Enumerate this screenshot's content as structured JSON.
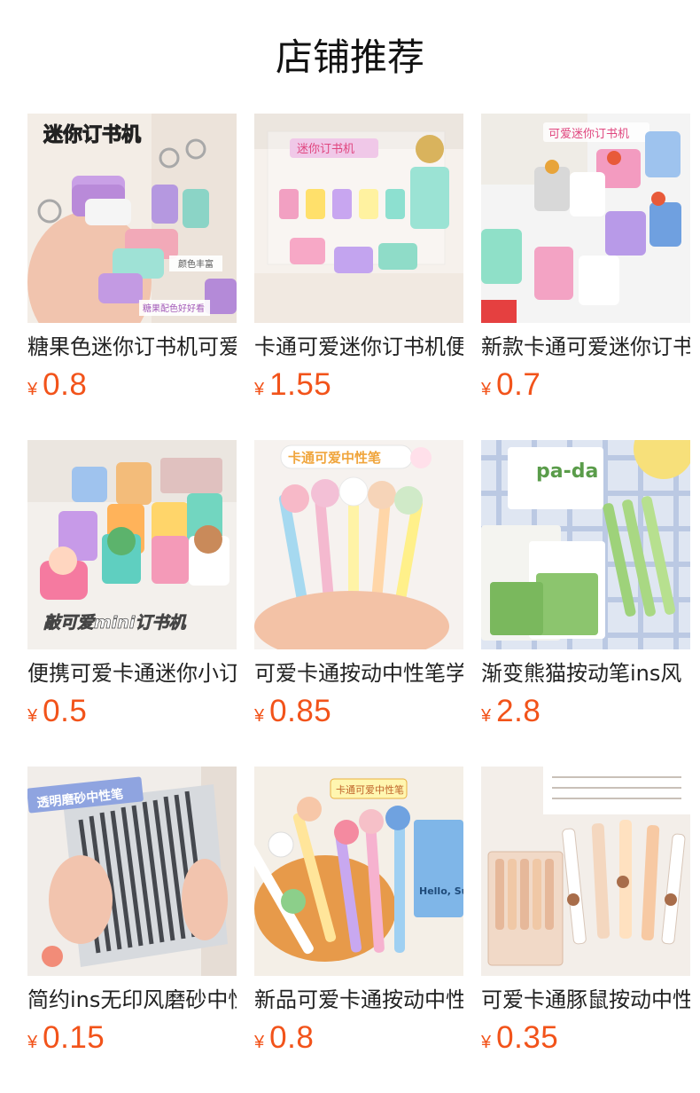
{
  "header": {
    "title": "店铺推荐"
  },
  "currency_symbol": "¥",
  "products": [
    {
      "name": "糖果色迷你订书机可爱",
      "price": "0.8",
      "image": {
        "badge": "迷你订书机",
        "tag1": "颜色丰富",
        "tag2": "糖果配色好好看"
      }
    },
    {
      "name": "卡通可爱迷你订书机便携",
      "price": "1.55",
      "image": {
        "badge": "迷你订书机"
      }
    },
    {
      "name": "新款卡通可爱迷你订书机",
      "price": "0.7",
      "image": {
        "badge": "可爱迷你订书机"
      }
    },
    {
      "name": "便携可爱卡通迷你小订书机",
      "price": "0.5",
      "image": {
        "badge": "敲可爱mini订书机"
      }
    },
    {
      "name": "可爱卡通按动中性笔学生",
      "price": "0.85",
      "image": {
        "badge": "卡通可爱中性笔"
      }
    },
    {
      "name": "渐变熊猫按动笔ins风",
      "price": "2.8",
      "image": {
        "badge": "pa-da"
      }
    },
    {
      "name": "简约ins无印风磨砂中性笔",
      "price": "0.15",
      "image": {
        "badge": "透明磨砂中性笔"
      }
    },
    {
      "name": "新品可爱卡通按动中性笔",
      "price": "0.8",
      "image": {
        "badge": "卡通可爱中性笔",
        "tag1": "Hello, Su"
      }
    },
    {
      "name": "可爱卡通豚鼠按动中性笔",
      "price": "0.35",
      "image": {
        "badge": ""
      }
    }
  ]
}
